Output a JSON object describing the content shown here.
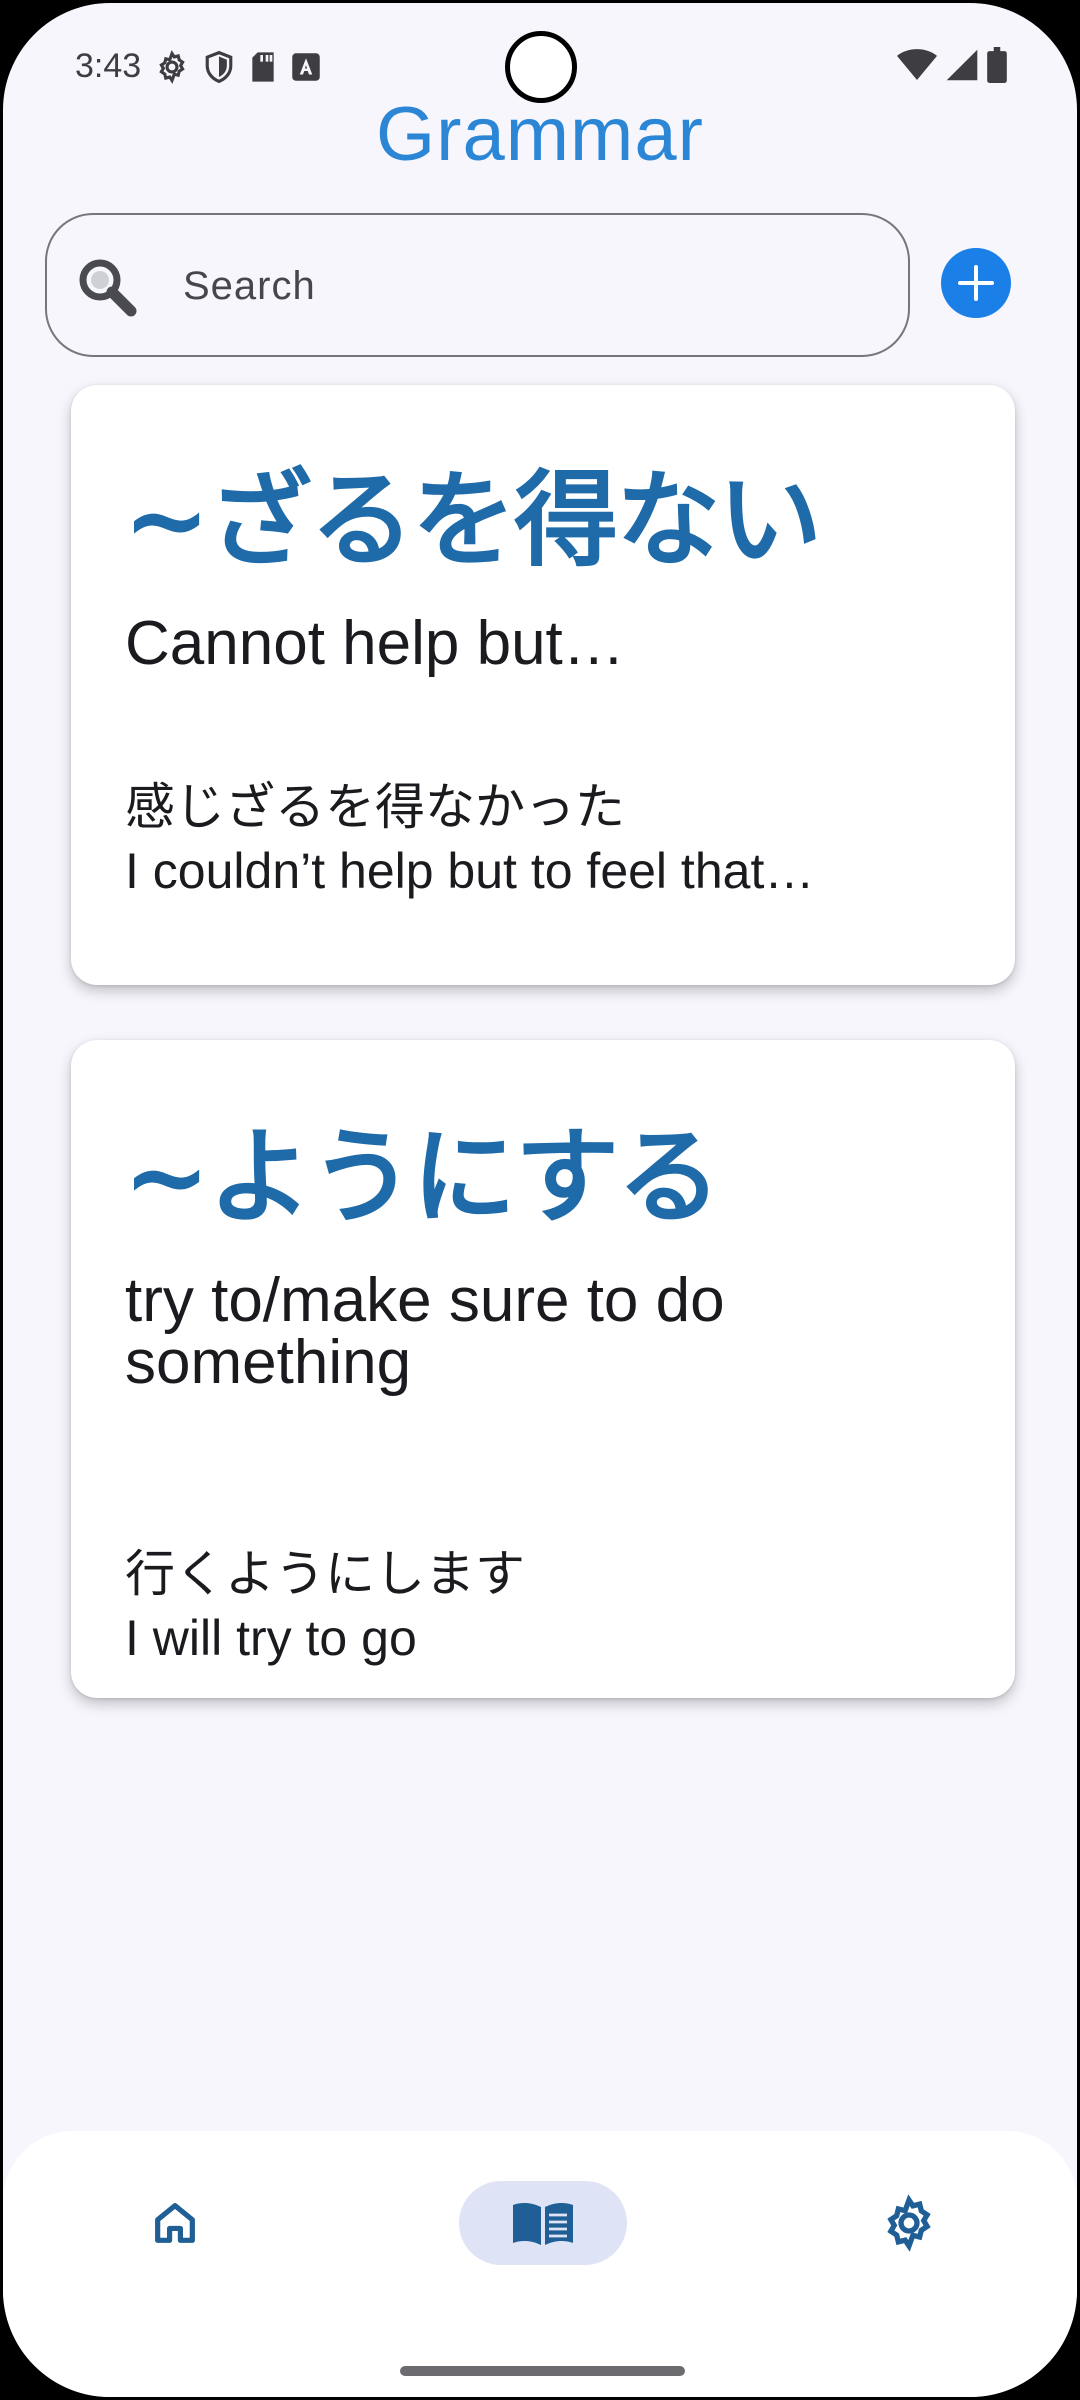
{
  "status_bar": {
    "time": "3:43",
    "left_icons": [
      "gear-icon",
      "shield-icon",
      "sd-card-icon",
      "a-badge-icon"
    ],
    "right_icons": [
      "wifi-icon",
      "signal-icon",
      "battery-icon"
    ]
  },
  "header": {
    "title": "Grammar",
    "accent_color": "#2b86d6"
  },
  "search": {
    "placeholder": "Search",
    "value": ""
  },
  "add_button": {
    "icon": "plus-icon",
    "color": "#1a7fe6"
  },
  "cards": [
    {
      "title": "~ざるを得ない",
      "meaning": "Cannot help but…",
      "example": "感じざるを得なかった",
      "translation": "I couldn’t help but to feel that…"
    },
    {
      "title": "~ようにする",
      "meaning": "try to/make sure to do something",
      "example": "行くようにします",
      "translation": "I will try to go"
    }
  ],
  "bottom_nav": {
    "items": [
      {
        "icon": "home-icon",
        "selected": false
      },
      {
        "icon": "book-icon",
        "selected": true
      },
      {
        "icon": "settings-icon",
        "selected": false
      }
    ],
    "icon_color": "#1f5f96",
    "selected_pill_color": "#dfe3f6"
  }
}
